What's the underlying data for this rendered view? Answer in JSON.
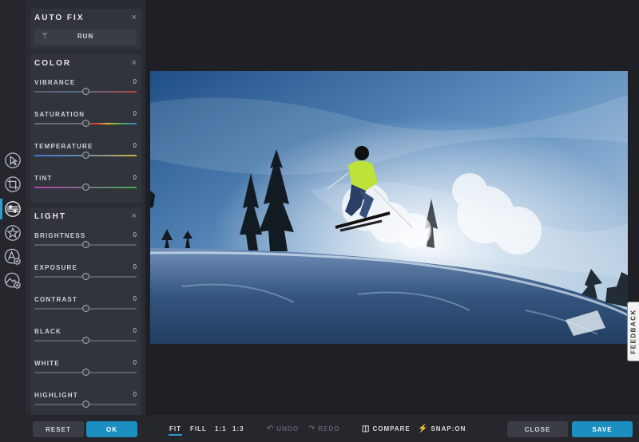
{
  "rail": {
    "items": [
      {
        "icon": "magic-select-icon"
      },
      {
        "icon": "crop-icon"
      },
      {
        "icon": "adjust-icon"
      },
      {
        "icon": "effects-star-icon"
      },
      {
        "icon": "text-overlay-icon"
      },
      {
        "icon": "image-overlay-icon"
      }
    ],
    "active_index": 2
  },
  "autofix": {
    "title": "AUTO FIX",
    "close": "×",
    "run_label": "RUN"
  },
  "color": {
    "title": "COLOR",
    "close": "×",
    "sliders": [
      {
        "label": "VIBRANCE",
        "value": "0",
        "level": 0.5
      },
      {
        "label": "SATURATION",
        "value": "0",
        "level": 0.5
      },
      {
        "label": "TEMPERATURE",
        "value": "0",
        "level": 0.5
      },
      {
        "label": "TINT",
        "value": "0",
        "level": 0.5
      }
    ]
  },
  "light": {
    "title": "LIGHT",
    "close": "×",
    "sliders": [
      {
        "label": "BRIGHTNESS",
        "value": "0",
        "level": 0.5
      },
      {
        "label": "EXPOSURE",
        "value": "0",
        "level": 0.5
      },
      {
        "label": "CONTRAST",
        "value": "0",
        "level": 0.5
      },
      {
        "label": "BLACK",
        "value": "0",
        "level": 0.5
      },
      {
        "label": "WHITE",
        "value": "0",
        "level": 0.5
      },
      {
        "label": "HIGHLIGHT",
        "value": "0",
        "level": 0.5
      }
    ]
  },
  "footer": {
    "reset_label": "RESET",
    "ok_label": "OK",
    "fit_label": "FIT",
    "fill_label": "FILL",
    "zoom_1_1": "1:1",
    "zoom_1_3": "1:3",
    "undo_label": "UNDO",
    "redo_label": "REDO",
    "compare_label": "COMPARE",
    "snap_label": "SNAP:ON",
    "close_label": "CLOSE",
    "save_label": "SAVE"
  },
  "feedback_label": "FEEDBACK",
  "colors": {
    "accent": "#1c8fc0",
    "panel": "#2a2c33",
    "background": "#1e2025"
  }
}
